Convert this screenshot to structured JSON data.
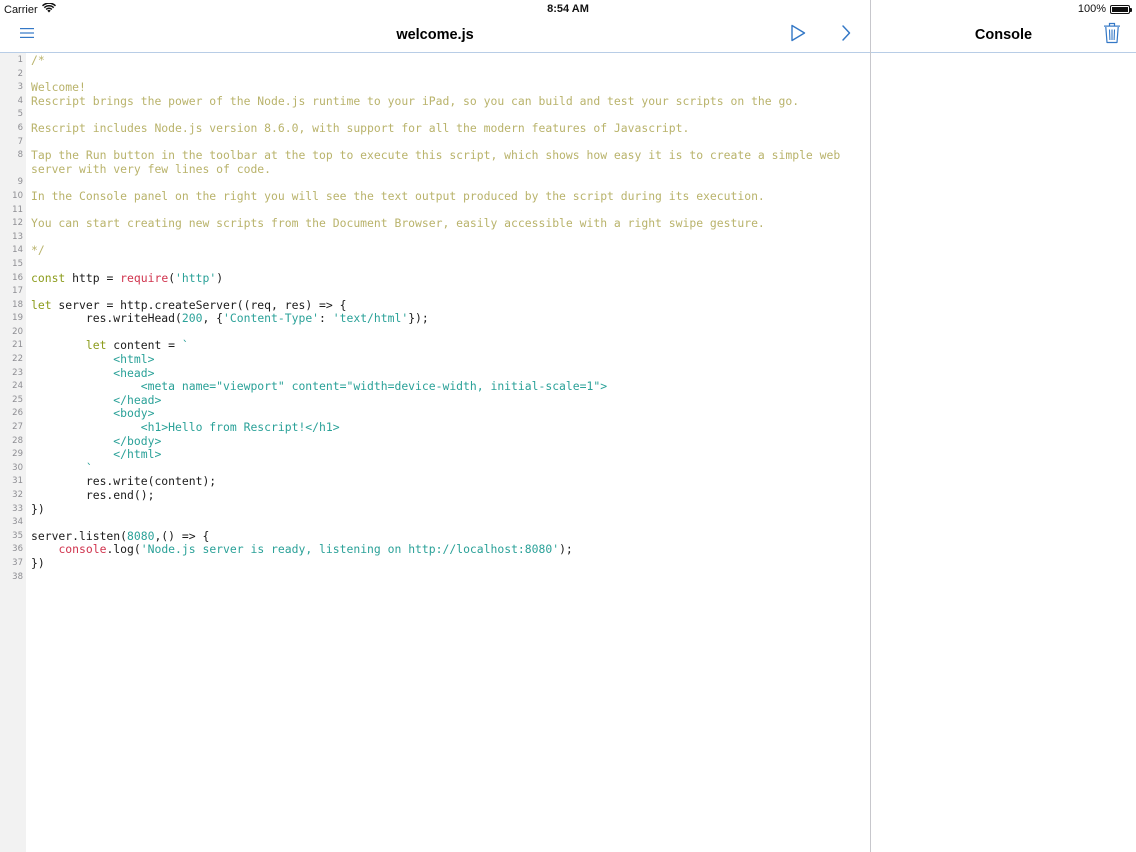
{
  "status_bar": {
    "carrier": "Carrier",
    "time": "8:54 AM",
    "battery": "100%"
  },
  "editor": {
    "title": "welcome.js",
    "menu_icon": "list-icon",
    "run_icon": "play-icon",
    "next_icon": "chevron-right-icon"
  },
  "console": {
    "title": "Console",
    "clear_icon": "trash-icon"
  },
  "colors": {
    "accent": "#3478c6",
    "comment": "#b9b36b",
    "keyword": "#8c9c1c",
    "string": "#2aa198",
    "require": "#d0334d"
  },
  "code": [
    {
      "n": "1",
      "tokens": [
        {
          "t": "/*",
          "c": "comment"
        }
      ]
    },
    {
      "n": "2",
      "tokens": []
    },
    {
      "n": "3",
      "tokens": [
        {
          "t": "Welcome!",
          "c": "comment"
        }
      ]
    },
    {
      "n": "4",
      "tokens": [
        {
          "t": "Rescript brings the power of the Node.js runtime to your iPad, so you can build and test your scripts on the go.",
          "c": "comment"
        }
      ]
    },
    {
      "n": "5",
      "tokens": []
    },
    {
      "n": "6",
      "tokens": [
        {
          "t": "Rescript includes Node.js version 8.6.0, with support for all the modern features of Javascript.",
          "c": "comment"
        }
      ]
    },
    {
      "n": "7",
      "tokens": []
    },
    {
      "n": "8",
      "tokens": [
        {
          "t": "Tap the Run button in the toolbar at the top to execute this script, which shows how easy it is to create a simple web",
          "c": "comment"
        }
      ]
    },
    {
      "n": "",
      "tokens": [
        {
          "t": "server with very few lines of code.",
          "c": "comment"
        }
      ]
    },
    {
      "n": "9",
      "tokens": []
    },
    {
      "n": "10",
      "tokens": [
        {
          "t": "In the Console panel on the right you will see the text output produced by the script during its execution.",
          "c": "comment"
        }
      ]
    },
    {
      "n": "11",
      "tokens": []
    },
    {
      "n": "12",
      "tokens": [
        {
          "t": "You can start creating new scripts from the Document Browser, easily accessible with a right swipe gesture.",
          "c": "comment"
        }
      ]
    },
    {
      "n": "13",
      "tokens": []
    },
    {
      "n": "14",
      "tokens": [
        {
          "t": "*/",
          "c": "comment"
        }
      ]
    },
    {
      "n": "15",
      "tokens": []
    },
    {
      "n": "16",
      "tokens": [
        {
          "t": "const",
          "c": "keyword"
        },
        {
          "t": " http = ",
          "c": "plain"
        },
        {
          "t": "require",
          "c": "require"
        },
        {
          "t": "(",
          "c": "plain"
        },
        {
          "t": "'http'",
          "c": "string"
        },
        {
          "t": ")",
          "c": "plain"
        }
      ]
    },
    {
      "n": "17",
      "tokens": []
    },
    {
      "n": "18",
      "tokens": [
        {
          "t": "let",
          "c": "keyword"
        },
        {
          "t": " server = http.createServer((req, res) => {",
          "c": "plain"
        }
      ]
    },
    {
      "n": "19",
      "tokens": [
        {
          "t": "        res.writeHead(",
          "c": "plain"
        },
        {
          "t": "200",
          "c": "number"
        },
        {
          "t": ", {",
          "c": "plain"
        },
        {
          "t": "'Content-Type'",
          "c": "string"
        },
        {
          "t": ": ",
          "c": "plain"
        },
        {
          "t": "'text/html'",
          "c": "string"
        },
        {
          "t": "});",
          "c": "plain"
        }
      ]
    },
    {
      "n": "20",
      "tokens": []
    },
    {
      "n": "21",
      "tokens": [
        {
          "t": "        ",
          "c": "plain"
        },
        {
          "t": "let",
          "c": "keyword"
        },
        {
          "t": " content = ",
          "c": "plain"
        },
        {
          "t": "`",
          "c": "string"
        }
      ]
    },
    {
      "n": "22",
      "tokens": [
        {
          "t": "            <html>",
          "c": "string"
        }
      ]
    },
    {
      "n": "23",
      "tokens": [
        {
          "t": "            <head>",
          "c": "string"
        }
      ]
    },
    {
      "n": "24",
      "tokens": [
        {
          "t": "                <meta name=\"viewport\" content=\"width=device-width, initial-scale=1\">",
          "c": "string"
        }
      ]
    },
    {
      "n": "25",
      "tokens": [
        {
          "t": "            </head>",
          "c": "string"
        }
      ]
    },
    {
      "n": "26",
      "tokens": [
        {
          "t": "            <body>",
          "c": "string"
        }
      ]
    },
    {
      "n": "27",
      "tokens": [
        {
          "t": "                <h1>Hello from Rescript!</h1>",
          "c": "string"
        }
      ]
    },
    {
      "n": "28",
      "tokens": [
        {
          "t": "            </body>",
          "c": "string"
        }
      ]
    },
    {
      "n": "29",
      "tokens": [
        {
          "t": "            </html>",
          "c": "string"
        }
      ]
    },
    {
      "n": "30",
      "tokens": [
        {
          "t": "        `",
          "c": "string"
        }
      ]
    },
    {
      "n": "31",
      "tokens": [
        {
          "t": "        res.write(content);",
          "c": "plain"
        }
      ]
    },
    {
      "n": "32",
      "tokens": [
        {
          "t": "        res.end();",
          "c": "plain"
        }
      ]
    },
    {
      "n": "33",
      "tokens": [
        {
          "t": "})",
          "c": "plain"
        }
      ]
    },
    {
      "n": "34",
      "tokens": []
    },
    {
      "n": "35",
      "tokens": [
        {
          "t": "server.listen(",
          "c": "plain"
        },
        {
          "t": "8080",
          "c": "number"
        },
        {
          "t": ",() => {",
          "c": "plain"
        }
      ]
    },
    {
      "n": "36",
      "tokens": [
        {
          "t": "    ",
          "c": "plain"
        },
        {
          "t": "console",
          "c": "require"
        },
        {
          "t": ".log(",
          "c": "plain"
        },
        {
          "t": "'Node.js server is ready, listening on http://localhost:8080'",
          "c": "string"
        },
        {
          "t": ");",
          "c": "plain"
        }
      ]
    },
    {
      "n": "37",
      "tokens": [
        {
          "t": "})",
          "c": "plain"
        }
      ]
    },
    {
      "n": "38",
      "tokens": []
    }
  ]
}
